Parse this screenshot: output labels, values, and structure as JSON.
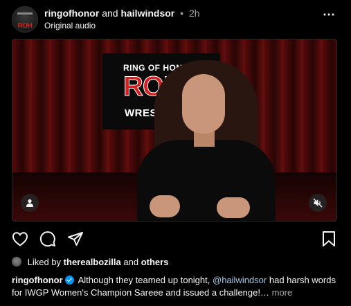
{
  "post": {
    "author": "ringofhonor",
    "connector": "and",
    "collaborator": "hailwindsor",
    "separator": "•",
    "time": "2h",
    "audio": "Original audio",
    "avatar_text": "ROH",
    "more_icon": "⋯"
  },
  "media": {
    "logo_top": "RING OF HONOR",
    "logo_mid": "ROH",
    "logo_bot": "WRESTLING",
    "user_icon": "user-icon",
    "mute_icon": "speaker-muted-icon"
  },
  "actions": {
    "like_icon": "heart-icon",
    "comment_icon": "comment-icon",
    "share_icon": "send-icon",
    "save_icon": "bookmark-icon"
  },
  "likes": {
    "prefix": "Liked by",
    "user": "therealbozilla",
    "and": "and",
    "others": "others"
  },
  "caption": {
    "user": "ringofhonor",
    "text1": "Although they teamed up tonight,",
    "mention": "@hailwindsor",
    "text2": "had harsh words for IWGP Women's Champion Sareee and issued a challenge!…",
    "more": "more"
  },
  "colors": {
    "background": "#000000",
    "text": "#f5f5f5",
    "secondary": "#a8a8a8",
    "verified": "#0095f6",
    "brand_red": "#d32020"
  }
}
